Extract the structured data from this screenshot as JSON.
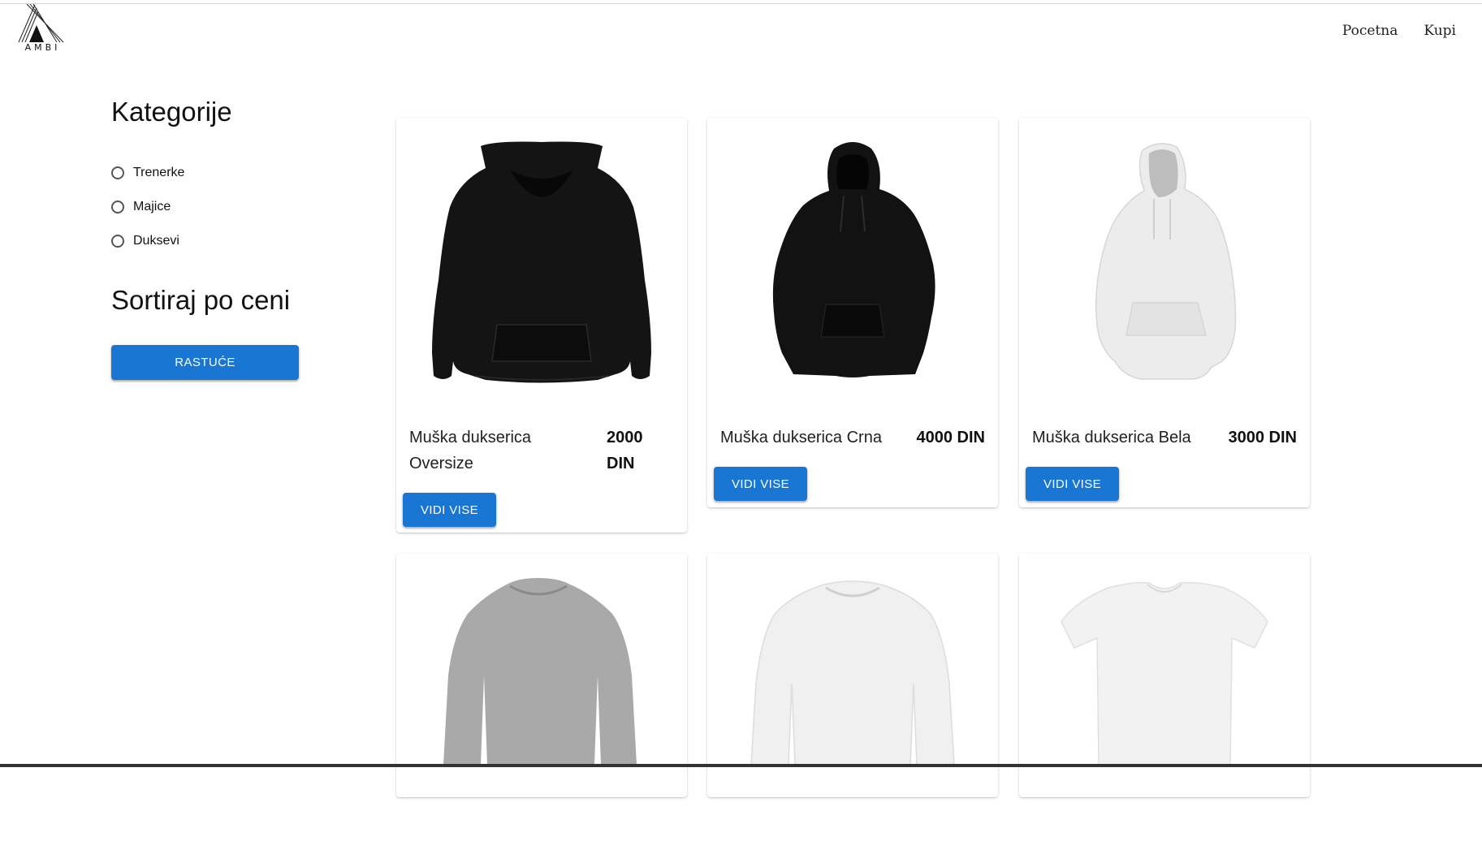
{
  "header": {
    "logo_text": "AMBI",
    "nav": [
      "Pocetna",
      "Kupi"
    ]
  },
  "sidebar": {
    "categories_title": "Kategorije",
    "categories": [
      "Trenerke",
      "Majice",
      "Duksevi"
    ],
    "sort_title": "Sortiraj po ceni",
    "sort_button": "RASTUĆE"
  },
  "products": [
    {
      "name_line1": "Muška dukserica",
      "name_line2": "Oversize",
      "price_line1": "2000",
      "price_line2": "DIN",
      "button": "VIDI VISE",
      "image": "black-hoodie-image"
    },
    {
      "name_line1": "Muška dukserica Crna",
      "name_line2": "",
      "price_line1": "4000 DIN",
      "price_line2": "",
      "button": "VIDI VISE",
      "image": "black-hoodie-image"
    },
    {
      "name_line1": "Muška dukserica Bela",
      "name_line2": "",
      "price_line1": "3000 DIN",
      "price_line2": "",
      "button": "VIDI VISE",
      "image": "white-hoodie-image"
    },
    {
      "image": "grey-longsleeve-image"
    },
    {
      "image": "white-longsleeve-image"
    },
    {
      "image": "white-tshirt-image"
    }
  ],
  "colors": {
    "primary": "#1976d2",
    "text": "#1a1a1a"
  }
}
